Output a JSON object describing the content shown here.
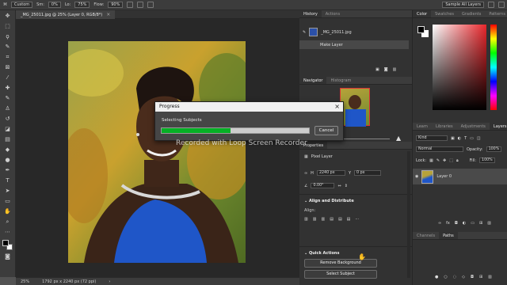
{
  "options_bar": {
    "mode_value": "Custom",
    "size_label": "Sm:",
    "size_value": "0%",
    "lo_label": "Lo:",
    "lo_value": "75%",
    "flow_label": "Flow:",
    "flow_value": "90%",
    "sample_value": "Sample All Layers"
  },
  "document": {
    "tab_title": "_MG_25011.jpg @ 25% (Layer 0, RGB/8*)",
    "zoom": "25%",
    "dimensions": "1792 px x 2240 px (72 ppi)"
  },
  "history": {
    "tabs": [
      "History",
      "Actions"
    ],
    "snapshot_label": "_MG_25011.jpg",
    "items": [
      "Make Layer"
    ]
  },
  "navigator": {
    "tabs": [
      "Navigator",
      "Histogram"
    ]
  },
  "properties": {
    "title": "Properties",
    "layer_type": "Pixel Layer",
    "h_label": "H",
    "h_value": "2240 px",
    "y_label": "Y",
    "y_value": "0 px",
    "angle_value": "0.00°",
    "align_title": "Align and Distribute",
    "align_label": "Align:",
    "quick_title": "Quick Actions",
    "remove_bg_label": "Remove Background",
    "select_subject_label": "Select Subject"
  },
  "color_panel": {
    "tabs": [
      "Color",
      "Swatches",
      "Gradients",
      "Patterns"
    ],
    "hue_color": "#e8262b"
  },
  "layers_panel": {
    "tabs": [
      "Learn",
      "Libraries",
      "Adjustments",
      "Layers"
    ],
    "kind_value": "Kind",
    "blend_value": "Normal",
    "opacity_label": "Opacity:",
    "opacity_value": "100%",
    "lock_label": "Lock:",
    "fill_label": "Fill:",
    "fill_value": "100%",
    "layer_name": "Layer 0"
  },
  "channels_panel": {
    "tabs": [
      "Channels",
      "Paths"
    ]
  },
  "dialog": {
    "title": "Progress",
    "message": "Selecting Subjects",
    "progress": 0.47,
    "cancel_label": "Cancel"
  },
  "watermark": "Recorded with Loop Screen Recorder",
  "colors": {
    "progress_green": "#06b025",
    "dress_blue": "#1f56c8"
  }
}
